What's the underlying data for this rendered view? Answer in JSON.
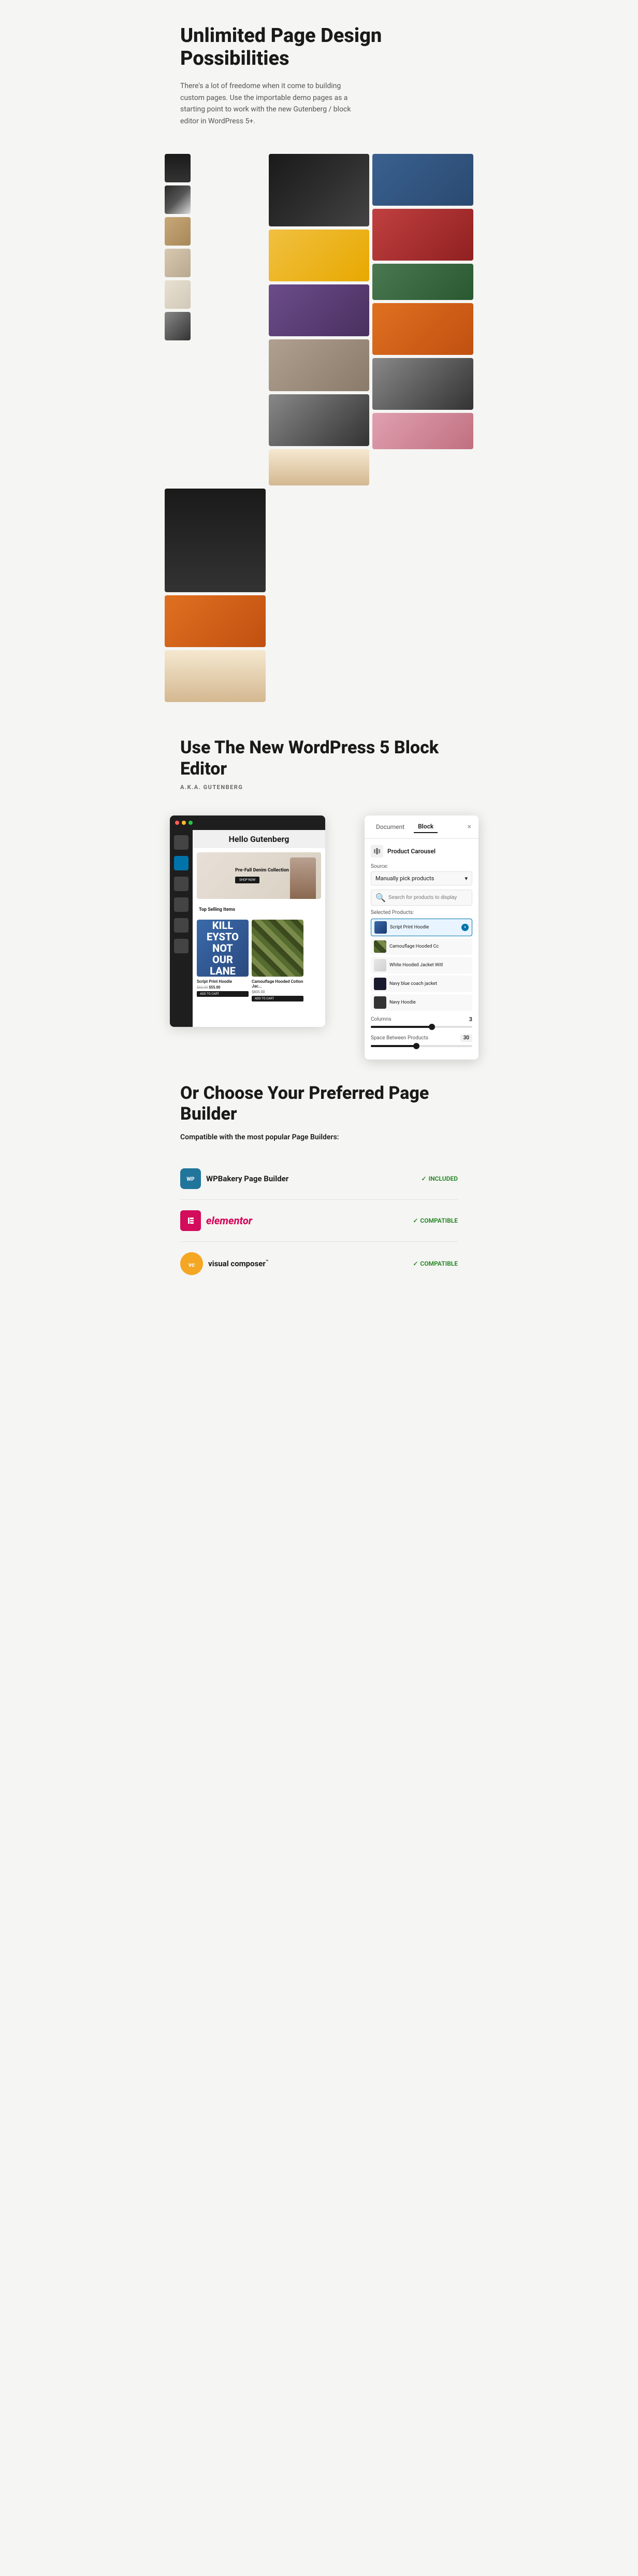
{
  "hero": {
    "title": "Unlimited Page Design Possibilities",
    "description": "There's a lot of freedome when it come to building custom pages. Use the importable demo pages as a starting point to work with the new Gutenberg / block editor in WordPress 5+."
  },
  "block_editor": {
    "title": "Use The New WordPress 5 Block Editor",
    "subtitle": "A.K.A. GUTENBERG",
    "wp_hello": "Hello Gutenberg",
    "wp_hero_title": "Pre-Fall Denim Collection",
    "wp_hero_btn": "SHOP NOW",
    "wp_top_selling": "Top Selling Items",
    "wp_product1_name": "Script Print Hoodie",
    "wp_product1_price_old": "$66.00",
    "wp_product1_price_new": "$55.00",
    "wp_product1_add": "ADD TO CART",
    "wp_product2_name": "Camouflage Hooded Cotton Jac...",
    "wp_product2_price": "$805.00",
    "wp_product2_add": "ADD TO CART",
    "panel_doc_tab": "Document",
    "panel_block_tab": "Block",
    "panel_close": "×",
    "panel_carousel_label": "Product Carousel",
    "panel_source_label": "Source:",
    "panel_source_value": "Manually pick products",
    "panel_search_placeholder": "Search for products to display",
    "panel_selected_label": "Selected Products:",
    "panel_product1": "Script Print Hoodie",
    "panel_product2": "Camouflage Hooded Cc",
    "panel_product3": "White Hooded Jacket Witl",
    "panel_product4": "Navy blue coach jacket",
    "panel_product5": "Navy Hoodie",
    "panel_columns_label": "Columns",
    "panel_columns_value": "3",
    "panel_space_label": "Space Between Products",
    "panel_space_value": "30"
  },
  "page_builder": {
    "title": "Or Choose Your Preferred Page Builder",
    "description": "Compatible with the most popular Page Builders:",
    "builders": [
      {
        "id": "wpbakery",
        "name": "WPBakery Page Builder",
        "status": "INCLUDED",
        "icon": "W"
      },
      {
        "id": "elementor",
        "name": "elementor",
        "status": "COMPATIBLE",
        "icon": "E"
      },
      {
        "id": "vc",
        "name": "visual composer™",
        "status": "COMPATIBLE",
        "icon": "vc"
      }
    ]
  },
  "gallery": {
    "col1": [
      {
        "color": "dark-model",
        "height": "tall"
      },
      {
        "color": "yellow",
        "height": "medium"
      },
      {
        "color": "bw",
        "height": "short"
      },
      {
        "color": "green",
        "height": "medium"
      }
    ],
    "col2": [
      {
        "color": "blue-jacket",
        "height": "medium"
      },
      {
        "color": "purple",
        "height": "medium"
      },
      {
        "color": "gray-dress",
        "height": "short"
      },
      {
        "color": "red-dress",
        "height": "medium"
      },
      {
        "color": "orange",
        "height": "short"
      }
    ],
    "col3": [
      {
        "color": "side-dark",
        "height": "tall"
      },
      {
        "color": "orange",
        "height": "medium"
      },
      {
        "color": "fashion-woman",
        "height": "medium"
      }
    ]
  }
}
